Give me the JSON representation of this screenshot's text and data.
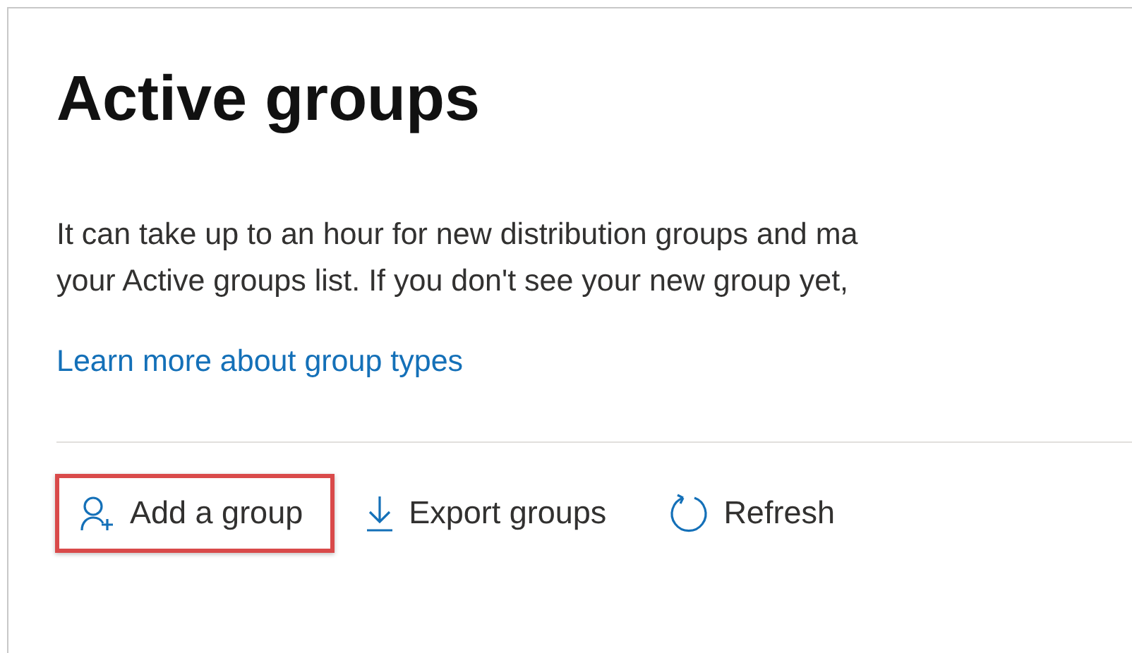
{
  "title": "Active groups",
  "description_lines": [
    "It can take up to an hour for new distribution groups and ma",
    "your Active groups list. If you don't see your new group yet,"
  ],
  "link": "Learn more about group types",
  "toolbar": [
    {
      "kind": "add",
      "label": "Add a group",
      "highlighted": true
    },
    {
      "kind": "export",
      "label": "Export groups",
      "highlighted": false
    },
    {
      "kind": "refresh",
      "label": "Refresh",
      "highlighted": false
    }
  ]
}
